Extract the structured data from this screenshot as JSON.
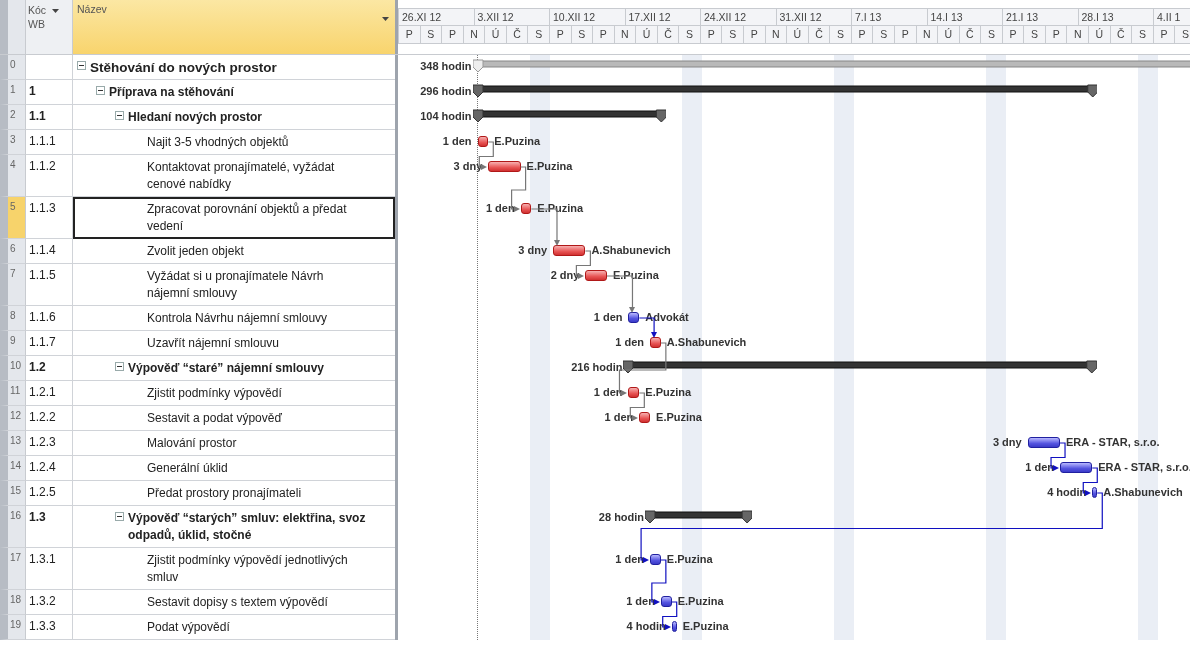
{
  "table": {
    "columns": [
      {
        "label": "Kóc WB",
        "sortable": true
      },
      {
        "label": "Název",
        "sortable": true,
        "selected": true
      }
    ]
  },
  "timescale": {
    "weeks": [
      "26.XI 12",
      "3.XII 12",
      "10.XII 12",
      "17.XII 12",
      "24.XII 12",
      "31.XII 12",
      "7.I 13",
      "14.I 13",
      "21.I 13",
      "28.I 13",
      "4.II 1"
    ],
    "days": [
      "P",
      "S",
      "P",
      "N",
      "Ú",
      "Č",
      "S",
      "P",
      "S",
      "P",
      "N",
      "Ú",
      "Č",
      "S",
      "P",
      "S",
      "P",
      "N",
      "Ú",
      "Č",
      "S",
      "P",
      "S",
      "P",
      "N",
      "Ú",
      "Č",
      "S",
      "P",
      "S",
      "P",
      "N",
      "Ú",
      "Č",
      "S",
      "P",
      "S"
    ]
  },
  "tasks": [
    {
      "id": "0",
      "name": "Stěhování do nových prostor",
      "kind": "project",
      "expanded": true,
      "selected": false,
      "duration": "348 hodin",
      "children": [
        {
          "id": "1",
          "wbs": "1",
          "name": "Příprava na stěhování",
          "kind": "summary",
          "expanded": true,
          "selected": false,
          "duration": "296 hodin",
          "children": [
            {
              "id": "2",
              "wbs": "1.1",
              "name": "Hledaní nových prostor",
              "kind": "summary",
              "expanded": true,
              "selected": false,
              "duration": "104 hodin",
              "children": [
                {
                  "id": "3",
                  "wbs": "1.1.1",
                  "name": "Najit 3-5 vhodných objektů",
                  "kind": "task",
                  "selected": false,
                  "critical": true,
                  "linked": false,
                  "duration": "1 den",
                  "resource": "E.Puzina"
                },
                {
                  "id": "4",
                  "wbs": "1.1.2",
                  "name": "Kontaktovat pronajímatelé, vyžádat cenové nabídky",
                  "kind": "task",
                  "selected": false,
                  "critical": true,
                  "linked": true,
                  "duration": "3 dny",
                  "resource": "E.Puzina"
                },
                {
                  "id": "5",
                  "wbs": "1.1.3",
                  "name": "Zpracovat porovnání objektů a předat vedení",
                  "kind": "task",
                  "selected": true,
                  "critical": true,
                  "linked": true,
                  "duration": "1 den",
                  "resource": "E.Puzina"
                },
                {
                  "id": "6",
                  "wbs": "1.1.4",
                  "name": "Zvolit jeden objekt",
                  "kind": "task",
                  "selected": false,
                  "critical": true,
                  "linked": true,
                  "duration": "3 dny",
                  "resource": "A.Shabunevich"
                },
                {
                  "id": "7",
                  "wbs": "1.1.5",
                  "name": "Vyžádat si u pronajímatele Návrh nájemní smlouvy",
                  "kind": "task",
                  "selected": false,
                  "critical": true,
                  "linked": true,
                  "duration": "2 dny",
                  "resource": "E.Puzina"
                },
                {
                  "id": "8",
                  "wbs": "1.1.6",
                  "name": "Kontrola Návrhu nájemní smlouvy",
                  "kind": "task",
                  "selected": false,
                  "critical": false,
                  "linked": true,
                  "duration": "1 den",
                  "resource": "Advokát"
                },
                {
                  "id": "9",
                  "wbs": "1.1.7",
                  "name": "Uzavřít nájemní smlouvu",
                  "kind": "task",
                  "selected": false,
                  "critical": true,
                  "linked": true,
                  "duration": "1 den",
                  "resource": "A.Shabunevich"
                }
              ]
            },
            {
              "id": "10",
              "wbs": "1.2",
              "name": "Výpověď “staré” nájemní smlouvy",
              "kind": "summary",
              "expanded": true,
              "selected": false,
              "duration": "216 hodin",
              "children": [
                {
                  "id": "11",
                  "wbs": "1.2.1",
                  "name": "Zjistit podmínky výpovědí",
                  "kind": "task",
                  "selected": false,
                  "critical": true,
                  "linked": true,
                  "duration": "1 den",
                  "resource": "E.Puzina"
                },
                {
                  "id": "12",
                  "wbs": "1.2.2",
                  "name": "Sestavit a podat výpověď",
                  "kind": "task",
                  "selected": false,
                  "critical": true,
                  "linked": true,
                  "duration": "1 den",
                  "resource": "E.Puzina"
                },
                {
                  "id": "13",
                  "wbs": "1.2.3",
                  "name": "Malování prostor",
                  "kind": "task",
                  "selected": false,
                  "critical": false,
                  "linked": false,
                  "duration": "3 dny",
                  "resource": "ERA - STAR, s.r.o."
                },
                {
                  "id": "14",
                  "wbs": "1.2.4",
                  "name": "Generální úklid",
                  "kind": "task",
                  "selected": false,
                  "critical": false,
                  "linked": true,
                  "duration": "1 den",
                  "resource": "ERA - STAR, s.r.o."
                },
                {
                  "id": "15",
                  "wbs": "1.2.5",
                  "name": "Předat prostory pronajímateli",
                  "kind": "task",
                  "selected": false,
                  "critical": false,
                  "linked": true,
                  "duration": "4 hodin",
                  "resource": "A.Shabunevich"
                }
              ]
            },
            {
              "id": "16",
              "wbs": "1.3",
              "name": "Výpověď “starých” smluv: elektřina, svoz odpadů, úklid, stočné",
              "kind": "summary",
              "expanded": true,
              "selected": false,
              "duration": "28 hodin",
              "children": [
                {
                  "id": "17",
                  "wbs": "1.3.1",
                  "name": "Zjistit podmínky výpovědí jednotlivých smluv",
                  "kind": "task",
                  "selected": false,
                  "critical": false,
                  "linked": true,
                  "duration": "1 den",
                  "resource": "E.Puzina"
                },
                {
                  "id": "18",
                  "wbs": "1.3.2",
                  "name": "Sestavit dopisy s textem výpovědí",
                  "kind": "task",
                  "selected": false,
                  "critical": false,
                  "linked": true,
                  "duration": "1 den",
                  "resource": "E.Puzina"
                },
                {
                  "id": "19",
                  "wbs": "1.3.3",
                  "name": "Podat výpovědí",
                  "kind": "task",
                  "selected": false,
                  "critical": false,
                  "linked": true,
                  "duration": "4 hodin",
                  "resource": "E.Puzina"
                }
              ]
            }
          ]
        }
      ]
    }
  ]
}
